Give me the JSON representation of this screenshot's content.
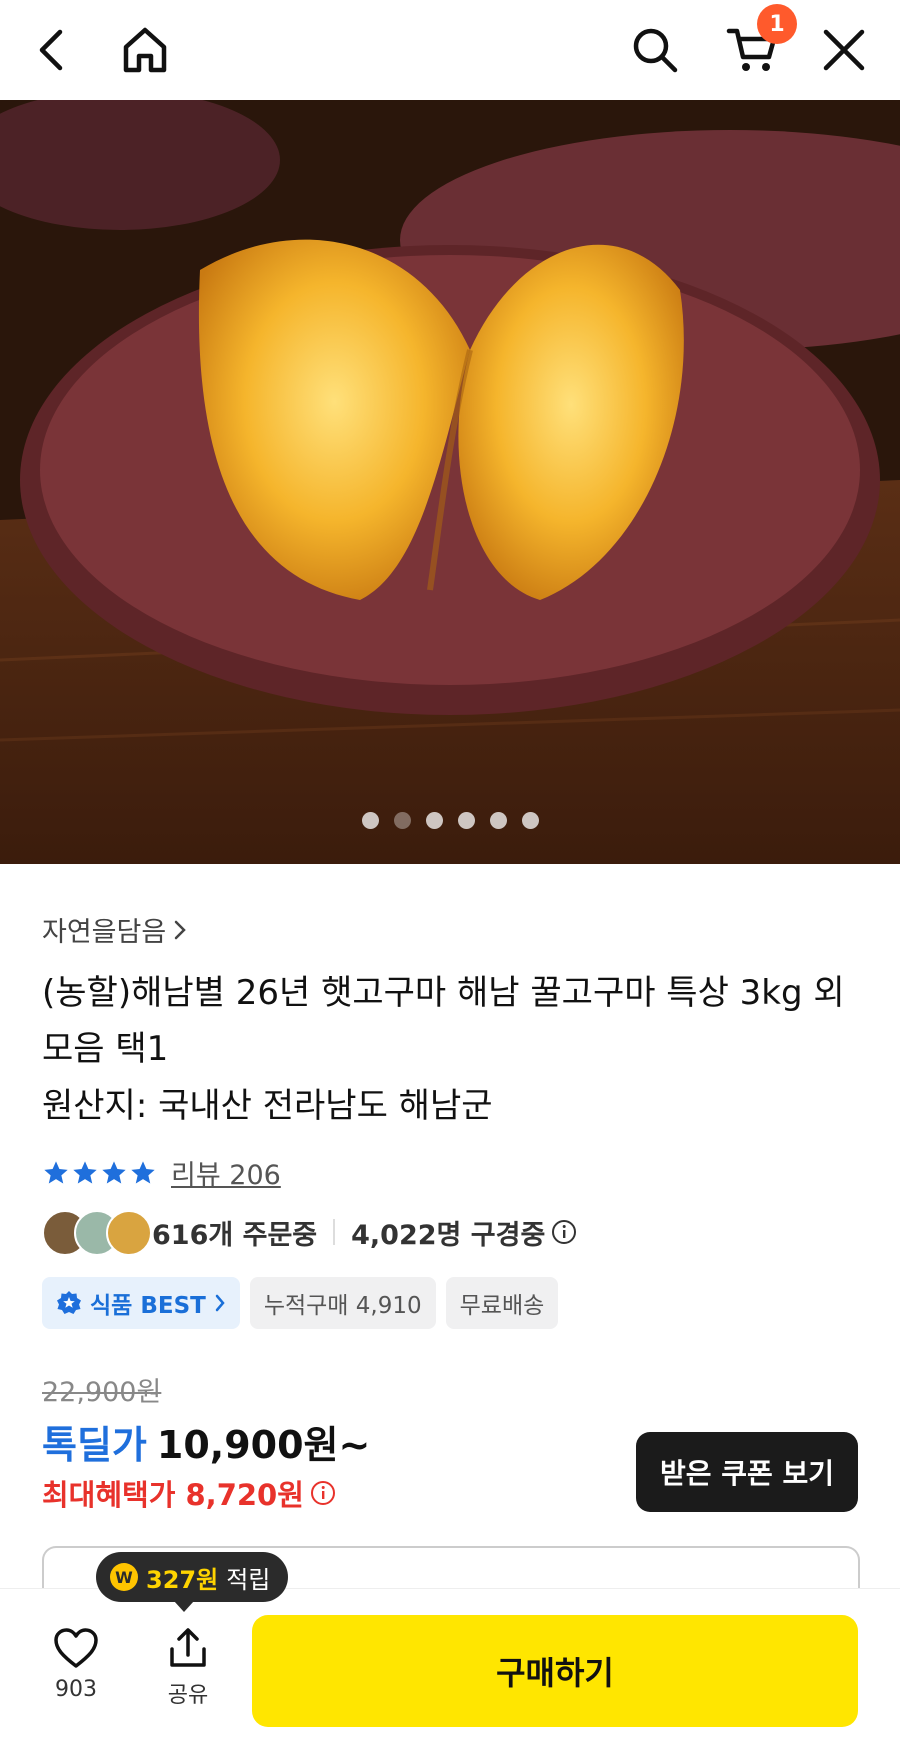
{
  "topbar": {
    "back_icon": "chevron-left-icon",
    "home_icon": "home-icon",
    "search_icon": "search-icon",
    "cart_icon": "cart-icon",
    "cart_badge": "1",
    "close_icon": "close-icon"
  },
  "carousel": {
    "slide_count": 6,
    "active_index": 1
  },
  "product": {
    "seller": "자연을담음",
    "title": "(농할)해남별 26년 햇고구마 해남 꿀고구마 특상 3kg 외 모음 택1",
    "origin": "원산지: 국내산 전라남도 해남군"
  },
  "rating": {
    "stars": 4,
    "review_label": "리뷰 206"
  },
  "social": {
    "orders": "616개 주문중",
    "viewers": "4,022명 구경중"
  },
  "tags": {
    "best": "식품 BEST",
    "cumulative": "누적구매 4,910",
    "shipping": "무료배송"
  },
  "price": {
    "original": "22,900원",
    "deal_label": "톡딜가",
    "deal_price": "10,900원~",
    "max_benefit": "최대혜택가 8,720원",
    "coupon_button": "받은 쿠폰 보기"
  },
  "tooltip": {
    "amount": "327원",
    "suffix": "적립",
    "coin_symbol": "W"
  },
  "bottom": {
    "like_count": "903",
    "share_label": "공유",
    "buy_button": "구매하기"
  },
  "colors": {
    "deal_blue": "#1f6fdc",
    "benefit_red": "#e8322b",
    "buy_yellow": "#ffe600",
    "badge_orange": "#ff5a2c"
  }
}
